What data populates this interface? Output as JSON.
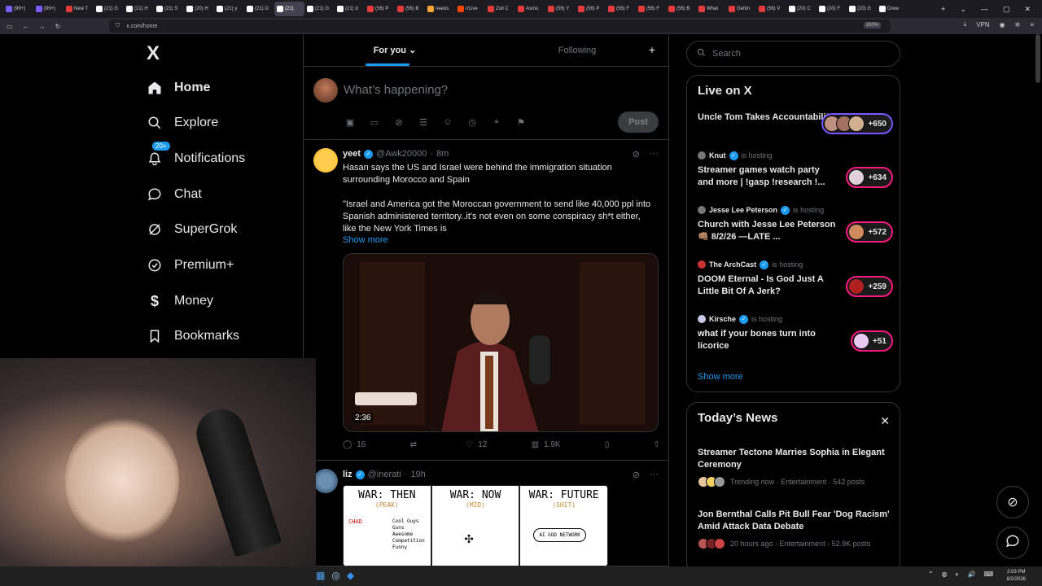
{
  "browser": {
    "tabs": [
      {
        "label": "(99+)",
        "color": "#7b5cff"
      },
      {
        "label": "(99+)",
        "color": "#7b5cff"
      },
      {
        "label": "New T",
        "color": "#e33b3b"
      },
      {
        "label": "(21) G",
        "color": "#ffffff"
      },
      {
        "label": "(21) H",
        "color": "#ffffff"
      },
      {
        "label": "(21) S",
        "color": "#ffffff"
      },
      {
        "label": "(20) H",
        "color": "#ffffff"
      },
      {
        "label": "(21) y",
        "color": "#ffffff"
      },
      {
        "label": "(21) D",
        "color": "#ffffff"
      },
      {
        "label": "(21)",
        "color": "#ffffff",
        "active": true
      },
      {
        "label": "(21) G",
        "color": "#ffffff"
      },
      {
        "label": "(21) d",
        "color": "#ffffff"
      },
      {
        "label": "(56) P",
        "color": "#e33b3b"
      },
      {
        "label": "(56) B",
        "color": "#e33b3b"
      },
      {
        "label": "needs",
        "color": "#f4a534"
      },
      {
        "label": "r/Live",
        "color": "#ff4500"
      },
      {
        "label": "Zoil C",
        "color": "#e33b3b"
      },
      {
        "label": "Asmo",
        "color": "#e33b3b"
      },
      {
        "label": "(56) Y",
        "color": "#e33b3b"
      },
      {
        "label": "(56) P",
        "color": "#e33b3b"
      },
      {
        "label": "(56) F",
        "color": "#e33b3b"
      },
      {
        "label": "(56) F",
        "color": "#e33b3b"
      },
      {
        "label": "(56) B",
        "color": "#e33b3b"
      },
      {
        "label": "What",
        "color": "#e33b3b"
      },
      {
        "label": "Gettin",
        "color": "#e33b3b"
      },
      {
        "label": "(56) V",
        "color": "#e33b3b"
      },
      {
        "label": "(20) C",
        "color": "#ffffff"
      },
      {
        "label": "(20) F",
        "color": "#ffffff"
      },
      {
        "label": "(20) G",
        "color": "#ffffff"
      },
      {
        "label": "Drew",
        "color": "#ffffff"
      }
    ],
    "url": "x.com/home",
    "zoom": "150%",
    "vpn": "VPN"
  },
  "sidebar": {
    "logo": "X",
    "notifications_badge": "20+",
    "items": [
      {
        "label": "Home",
        "icon": "home-icon",
        "active": true
      },
      {
        "label": "Explore",
        "icon": "search-icon"
      },
      {
        "label": "Notifications",
        "icon": "bell-icon"
      },
      {
        "label": "Chat",
        "icon": "chat-icon"
      },
      {
        "label": "SuperGrok",
        "icon": "grok-icon"
      },
      {
        "label": "Premium+",
        "icon": "premium-icon"
      },
      {
        "label": "Money",
        "icon": "money-icon"
      },
      {
        "label": "Bookmarks",
        "icon": "bookmark-icon"
      }
    ]
  },
  "timeline": {
    "tabs": [
      {
        "label": "For you",
        "active": true
      },
      {
        "label": "Following"
      }
    ],
    "composer": {
      "placeholder": "What’s happening?",
      "post_label": "Post"
    },
    "tweets": [
      {
        "name": "yeet",
        "handle": "@Awk20000",
        "time": "8m",
        "text1": "Hasan says the US and Israel were behind the immigration situation surrounding Morocco and Spain",
        "text2": "\"Israel and America got the Moroccan government to send like 40,000 ppl into Spanish administered territory..it's not even on some conspiracy sh*t either, like the New York Times is",
        "show_more": "Show more",
        "video_time": "2:36",
        "replies": "16",
        "reposts": "",
        "likes": "12",
        "views": "1.9K"
      },
      {
        "name": "liz",
        "handle": "@inerati",
        "time": "19h",
        "panels": [
          {
            "title": "WAR: THEN",
            "sub": "(PEAK)"
          },
          {
            "title": "WAR: NOW",
            "sub": "(MID)"
          },
          {
            "title": "WAR: FUTURE",
            "sub": "(SHIT)"
          }
        ],
        "panel_notes": [
          "CHAD",
          "Cool Guys",
          "Guns",
          "Awesome",
          "Competition",
          "Funny",
          "AI GOD NETWORK"
        ]
      }
    ]
  },
  "right": {
    "search_placeholder": "Search",
    "live": {
      "title": "Live on X",
      "items": [
        {
          "host": "",
          "hosting": "",
          "title": "Uncle Tom Takes Accountability",
          "count": "+650",
          "pill": "purple"
        },
        {
          "host": "Knut",
          "hosting": "is hosting",
          "title": "Streamer games watch party and more | !gasp !research !...",
          "count": "+634",
          "pill": "pink"
        },
        {
          "host": "Jesse Lee Peterson",
          "hosting": "is hosting",
          "title": "Church with Jesse Lee Peterson 👊🏽 8/2/26 —LATE ...",
          "count": "+572",
          "pill": "pink"
        },
        {
          "host": "The ArchCast",
          "hosting": "is hosting",
          "title": "DOOM Eternal - Is God Just A Little Bit Of A Jerk?",
          "count": "+259",
          "pill": "pink"
        },
        {
          "host": "Kirsche",
          "hosting": "is hosting",
          "title": "what if your bones turn into licorice",
          "count": "+51",
          "pill": "pink"
        }
      ],
      "show_more": "Show more"
    },
    "news": {
      "title": "Today’s News",
      "items": [
        {
          "title": "Streamer Tectone Marries Sophia in Elegant Ceremony",
          "meta": "Trending now · Entertainment · 542 posts"
        },
        {
          "title": "Jon Bernthal Calls Pit Bull Fear 'Dog Racism' Amid Attack Data Debate",
          "meta": "20 hours ago · Entertainment · 52.9K posts"
        }
      ]
    }
  },
  "taskbar": {
    "time": "2:03 PM",
    "date": "8/2/2026"
  },
  "colors": {
    "accent": "#1d9bf0",
    "live_pink": "#f91880",
    "live_purple": "#7856ff"
  }
}
